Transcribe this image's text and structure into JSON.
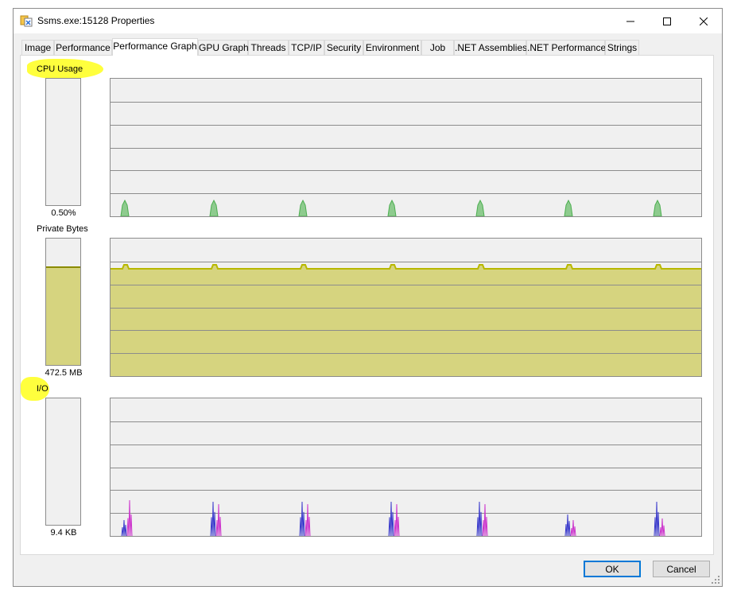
{
  "window": {
    "title": "Ssms.exe:15128 Properties",
    "icon": "app-process-icon"
  },
  "titlebar_buttons": {
    "minimize_icon": "minimize-icon",
    "maximize_icon": "maximize-icon",
    "close_icon": "close-icon"
  },
  "tabs": [
    {
      "label": "Image"
    },
    {
      "label": "Performance"
    },
    {
      "label": "Performance Graph",
      "selected": true
    },
    {
      "label": "GPU Graph"
    },
    {
      "label": "Threads"
    },
    {
      "label": "TCP/IP"
    },
    {
      "label": "Security"
    },
    {
      "label": "Environment"
    },
    {
      "label": "Job"
    },
    {
      "label": ".NET Assemblies"
    },
    {
      "label": ".NET Performance"
    },
    {
      "label": "Strings"
    }
  ],
  "sections": {
    "cpu": {
      "label": "CPU Usage",
      "value": "0.50%",
      "level": 0.005,
      "highlighted": true,
      "series_color": "#4caf50"
    },
    "private_bytes": {
      "label": "Private Bytes",
      "value": "472.5 MB",
      "level": 0.78,
      "highlighted": false,
      "series_color": "#b8b800"
    },
    "io": {
      "label": "I/O",
      "value": "9.4  KB",
      "level": 0.0,
      "highlighted": true,
      "series_colors": [
        "#3a3acc",
        "#cc33cc"
      ]
    }
  },
  "highlight_color": "#ffff33",
  "buttons": {
    "ok": "OK",
    "cancel": "Cancel"
  }
}
